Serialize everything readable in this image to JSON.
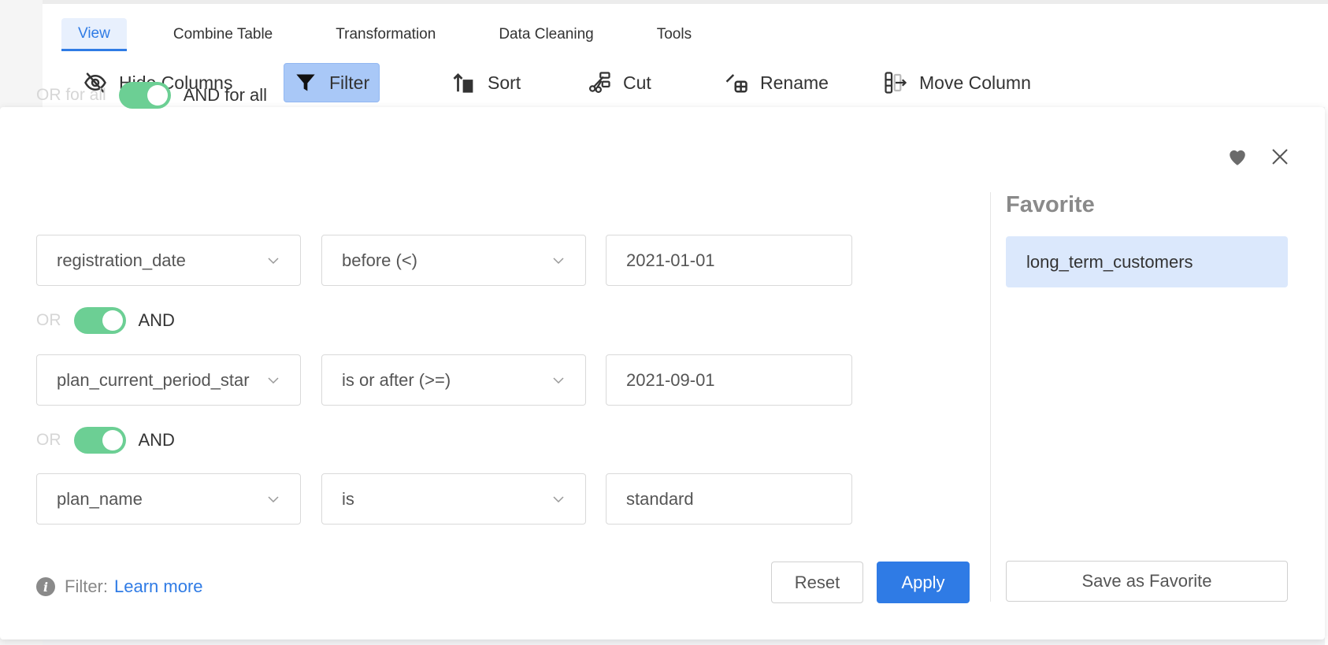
{
  "tabs": [
    {
      "label": "View",
      "active": true
    },
    {
      "label": "Combine Table",
      "active": false
    },
    {
      "label": "Transformation",
      "active": false
    },
    {
      "label": "Data Cleaning",
      "active": false
    },
    {
      "label": "Tools",
      "active": false
    }
  ],
  "toolbar": {
    "hide_columns": "Hide Columns",
    "filter": "Filter",
    "sort": "Sort",
    "cut": "Cut",
    "rename": "Rename",
    "move_column": "Move Column"
  },
  "filter": {
    "global_or": "OR for all",
    "global_and": "AND for all",
    "connector_or": "OR",
    "connector_and": "AND",
    "conditions": [
      {
        "column": "registration_date",
        "operator": "before (<)",
        "value": "2021-01-01"
      },
      {
        "column": "plan_current_period_star",
        "operator": "is or after (>=)",
        "value": "2021-09-01"
      },
      {
        "column": "plan_name",
        "operator": "is",
        "value": "standard"
      }
    ],
    "help_label": "Filter:",
    "help_link": "Learn more",
    "reset": "Reset",
    "apply": "Apply"
  },
  "favorite": {
    "title": "Favorite",
    "items": [
      "long_term_customers"
    ],
    "save_button": "Save as Favorite"
  },
  "colors": {
    "accent": "#2f7be5",
    "toggle_on": "#6ccf94",
    "filter_active_bg": "#a9c8f7",
    "favorite_item_bg": "#dbe8fc"
  }
}
